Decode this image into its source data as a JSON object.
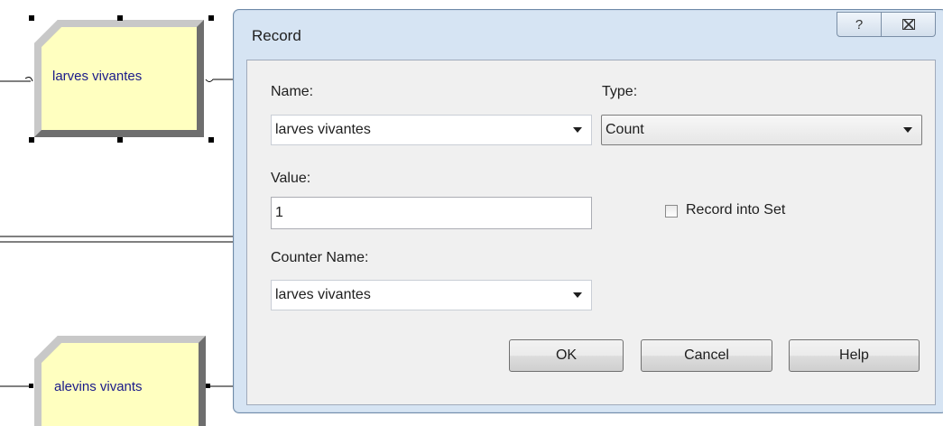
{
  "flowchart": {
    "modules": [
      {
        "label": "larves vivantes",
        "selected": true
      },
      {
        "label": "alevins vivants",
        "selected": false
      }
    ],
    "colors": {
      "module_face": "#ffffc0",
      "module_bevel": "#808080",
      "label_text": "#1a1a8a"
    }
  },
  "dialog": {
    "title": "Record",
    "help_glyph": "?",
    "close_glyph": "⌧",
    "name_label": "Name:",
    "name_value": "larves vivantes",
    "type_label": "Type:",
    "type_value": "Count",
    "value_label": "Value:",
    "value_value": "1",
    "record_into_set_label": "Record into Set",
    "record_into_set_checked": false,
    "counter_name_label": "Counter Name:",
    "counter_name_value": "larves vivantes",
    "buttons": {
      "ok": "OK",
      "cancel": "Cancel",
      "help": "Help"
    },
    "colors": {
      "frame": "#d6e4f3",
      "client": "#f0f0f0"
    }
  }
}
